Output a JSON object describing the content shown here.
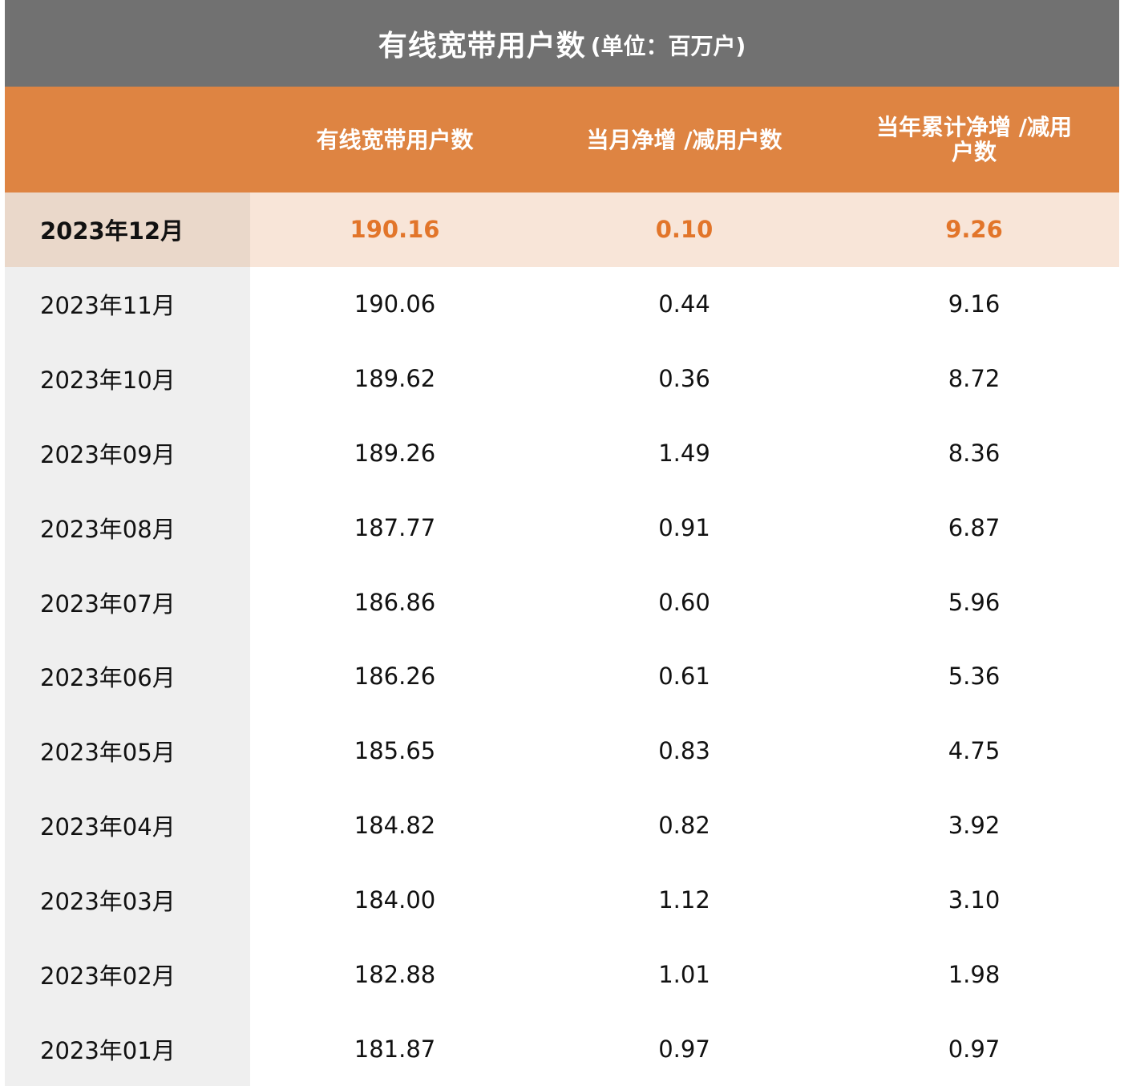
{
  "title": {
    "main": "有线宽带用户数",
    "unit": "(单位：百万户)"
  },
  "headers": [
    "",
    "有线宽带用户数",
    "当月净增 /减用户数",
    "当年累计净增 /减用户数"
  ],
  "colors": {
    "title_bg": "#717171",
    "header_bg": "#de8442",
    "highlight_bg": "#f8e5d8",
    "highlight_label_bg": "#ead8ca",
    "highlight_text": "#e2752a",
    "label_col_bg": "#efefef"
  },
  "chart_data": {
    "type": "table",
    "title": "有线宽带用户数 (单位：百万户)",
    "columns": [
      "",
      "有线宽带用户数",
      "当月净增 /减用户数",
      "当年累计净增 /减用户数"
    ],
    "rows": [
      [
        "2023年12月",
        "190.16",
        "0.10",
        "9.26"
      ],
      [
        "2023年11月",
        "190.06",
        "0.44",
        "9.16"
      ],
      [
        "2023年10月",
        "189.62",
        "0.36",
        "8.72"
      ],
      [
        "2023年09月",
        "189.26",
        "1.49",
        "8.36"
      ],
      [
        "2023年08月",
        "187.77",
        "0.91",
        "6.87"
      ],
      [
        "2023年07月",
        "186.86",
        "0.60",
        "5.96"
      ],
      [
        "2023年06月",
        "186.26",
        "0.61",
        "5.36"
      ],
      [
        "2023年05月",
        "185.65",
        "0.83",
        "4.75"
      ],
      [
        "2023年04月",
        "184.82",
        "0.82",
        "3.92"
      ],
      [
        "2023年03月",
        "184.00",
        "1.12",
        "3.10"
      ],
      [
        "2023年02月",
        "182.88",
        "1.01",
        "1.98"
      ],
      [
        "2023年01月",
        "181.87",
        "0.97",
        "0.97"
      ]
    ],
    "highlighted_row": 0
  }
}
